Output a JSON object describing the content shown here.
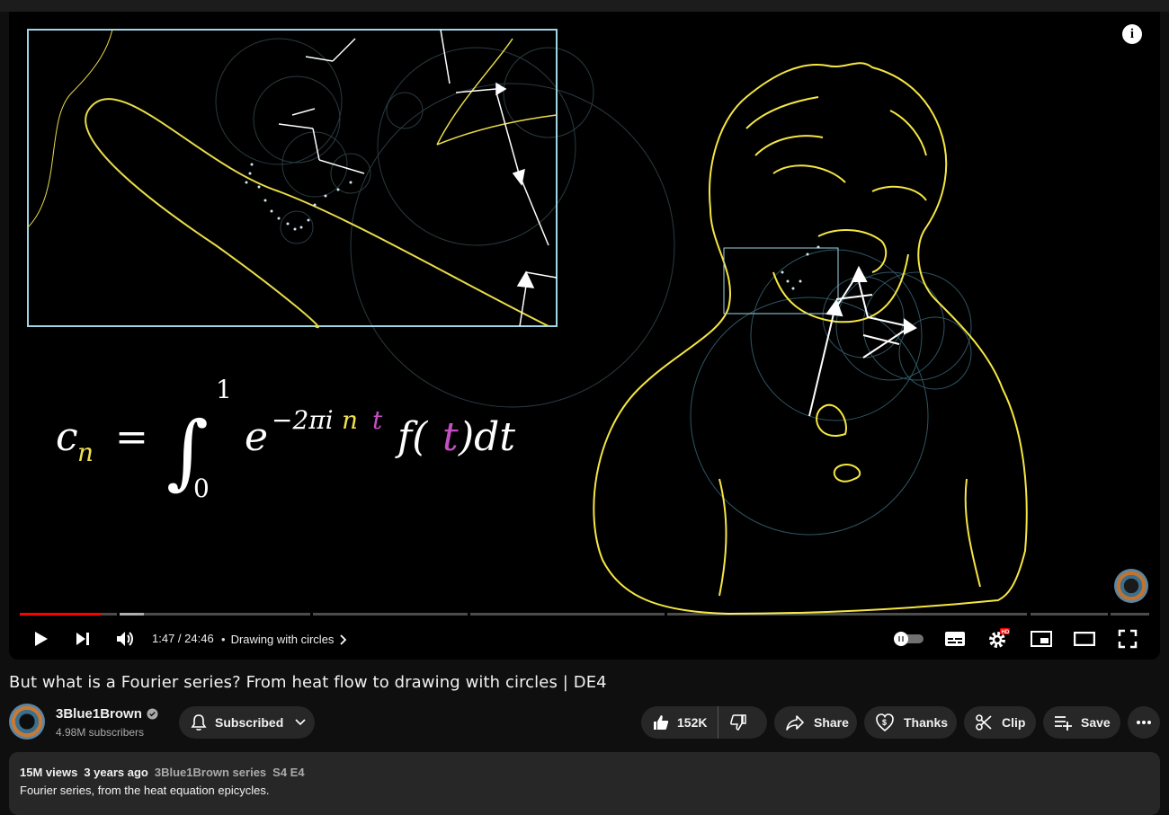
{
  "player": {
    "time": "1:47 / 24:46",
    "chapter": "Drawing with circles",
    "progress": {
      "played_fraction": 0.072,
      "buffered_fraction": 0.11
    }
  },
  "formula": {
    "c": "c",
    "n_sub": "n",
    "eq": "=",
    "upper": "1",
    "lower": "0",
    "e": "e",
    "exp_coeff": "−2πi",
    "exp_n": "n",
    "exp_t": "t",
    "f": "f(",
    "t": "t",
    "close": ")dt"
  },
  "video_title": "But what is a Fourier series? From heat flow to drawing with circles | DE4",
  "channel": {
    "name": "3Blue1Brown",
    "subscribers": "4.98M subscribers"
  },
  "actions": {
    "subscribed": "Subscribed",
    "likes": "152K",
    "share": "Share",
    "thanks": "Thanks",
    "clip": "Clip",
    "save": "Save"
  },
  "description": {
    "views": "15M views",
    "age": "3 years ago",
    "series": "3Blue1Brown series",
    "episode": "S4 E4",
    "text": "Fourier series, from the heat equation epicycles."
  },
  "colors": {
    "accent_red": "#ff0000",
    "drawing_yellow": "#f5e642",
    "inset_border": "#9fd6e6",
    "purple": "#c44fc4"
  },
  "icons": [
    "play-icon",
    "next-icon",
    "volume-icon",
    "chevron-right-icon",
    "autoplay-toggle",
    "subtitles-icon",
    "settings-icon",
    "miniplayer-icon",
    "theater-icon",
    "fullscreen-icon",
    "info-icon",
    "bell-icon",
    "chevron-down-icon",
    "thumbs-up-icon",
    "thumbs-down-icon",
    "share-icon",
    "thanks-icon",
    "clip-icon",
    "save-icon",
    "more-icon",
    "verified-icon"
  ]
}
